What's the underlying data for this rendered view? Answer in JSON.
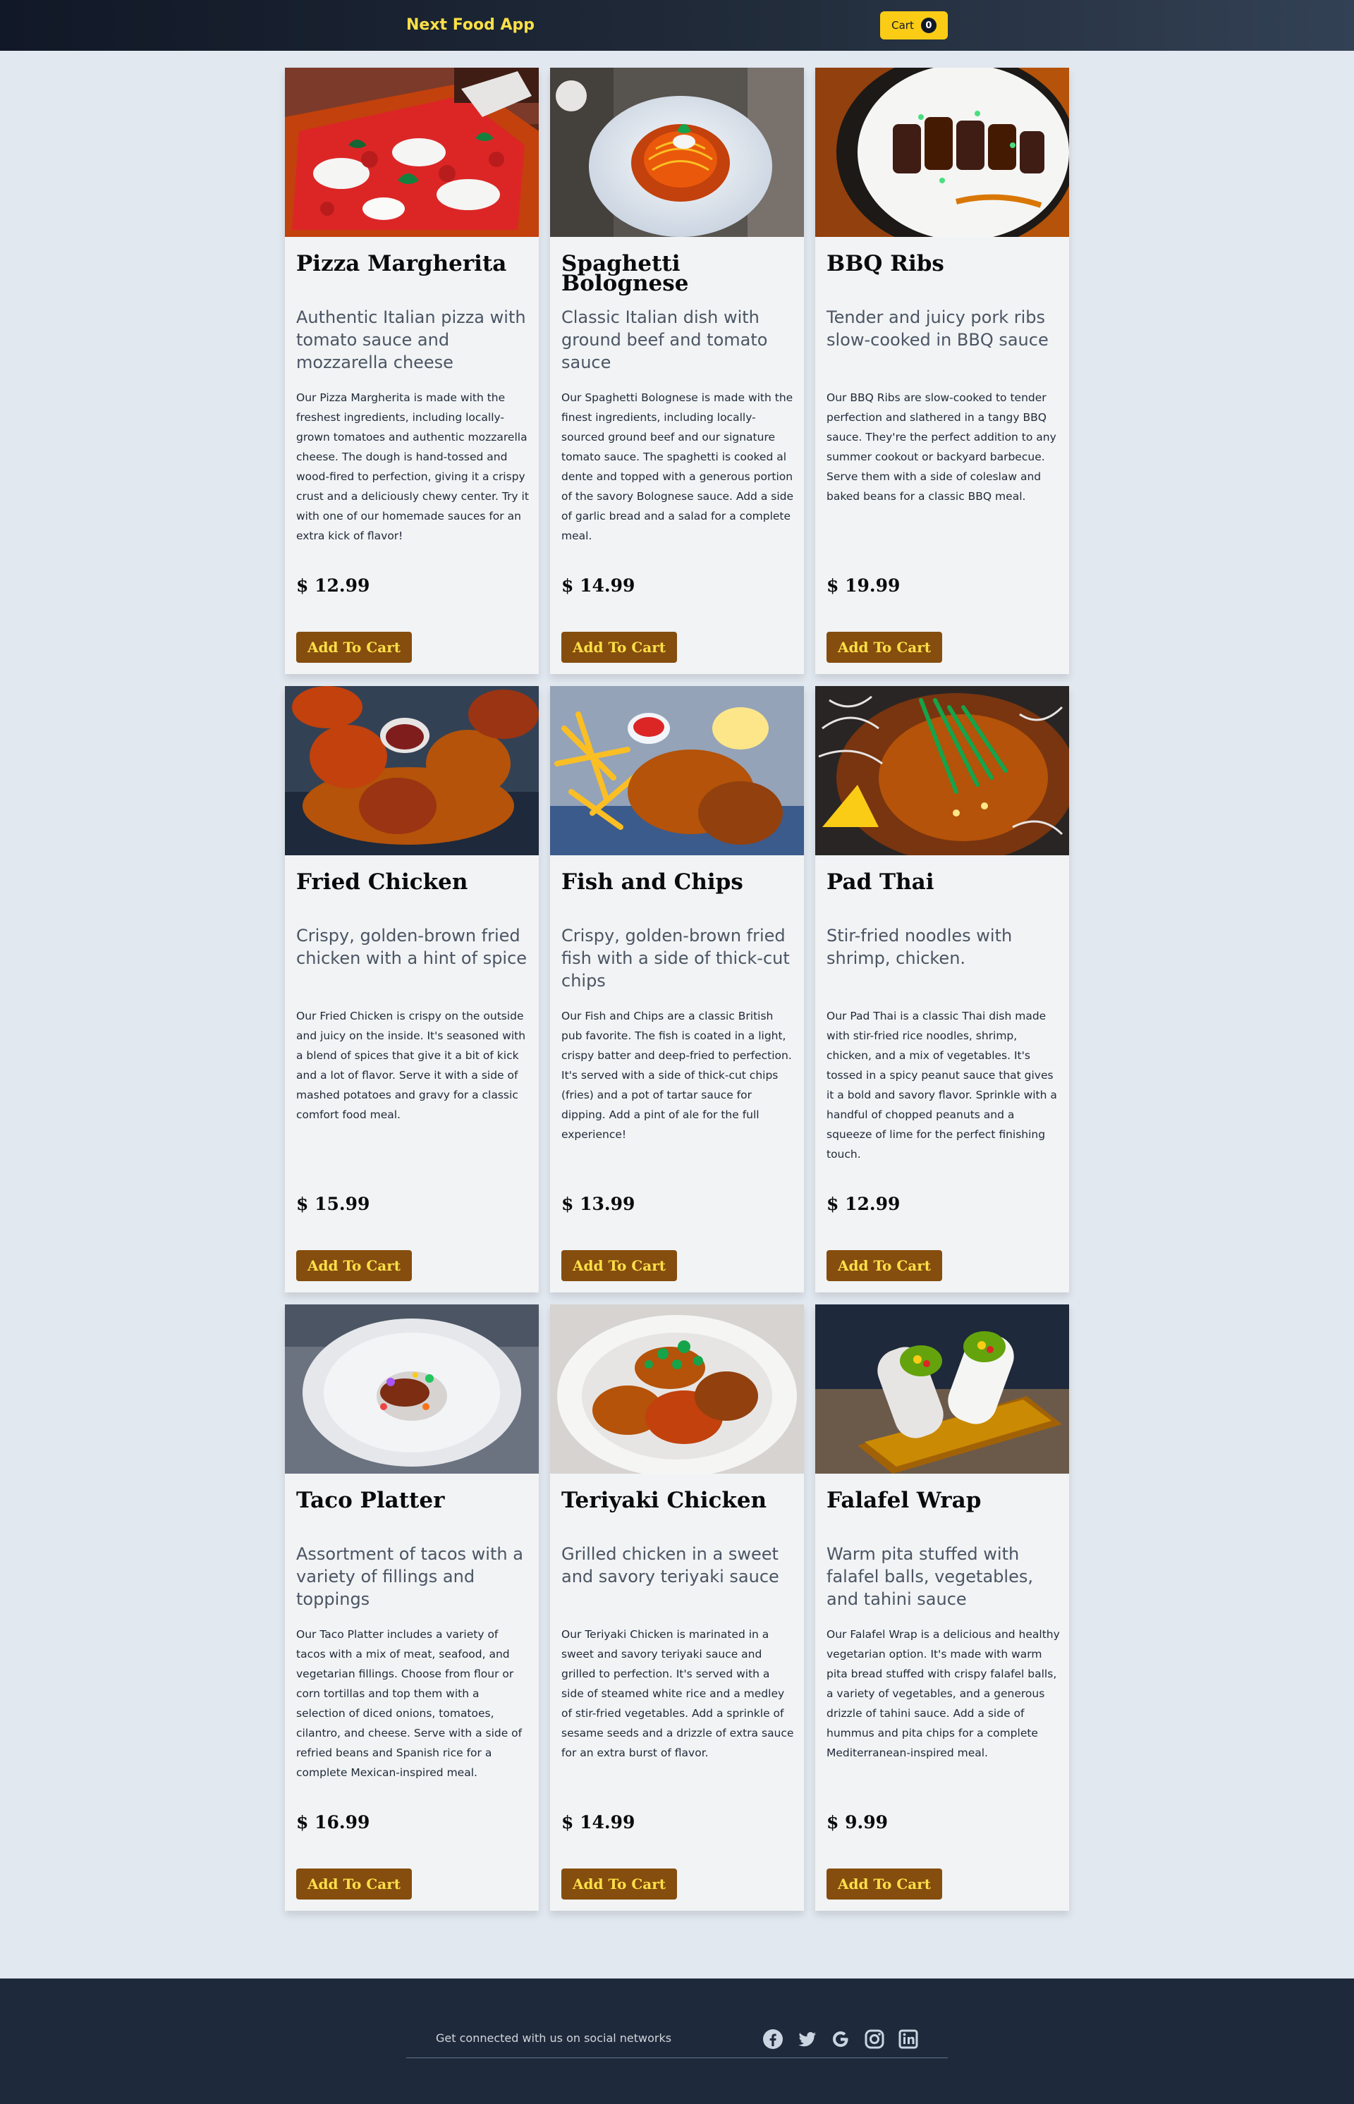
{
  "header": {
    "brand": "Next Food App",
    "cart_label": "Cart",
    "cart_count": "0"
  },
  "products": [
    {
      "title": "Pizza Margherita",
      "subtitle": "Authentic Italian pizza with tomato sauce and mozzarella cheese",
      "description": "Our Pizza Margherita is made with the freshest ingredients, including locally-grown tomatoes and authentic mozzarella cheese. The dough is hand-tossed and wood-fired to perfection, giving it a crispy crust and a deliciously chewy center. Try it with one of our homemade sauces for an extra kick of flavor!",
      "price": "$ 12.99",
      "button": "Add To Cart"
    },
    {
      "title": "Spaghetti Bolognese",
      "subtitle": "Classic Italian dish with ground beef and tomato sauce",
      "description": "Our Spaghetti Bolognese is made with the finest ingredients, including locally-sourced ground beef and our signature tomato sauce. The spaghetti is cooked al dente and topped with a generous portion of the savory Bolognese sauce. Add a side of garlic bread and a salad for a complete meal.",
      "price": "$ 14.99",
      "button": "Add To Cart"
    },
    {
      "title": "BBQ Ribs",
      "subtitle": "Tender and juicy pork ribs slow-cooked in BBQ sauce",
      "description": "Our BBQ Ribs are slow-cooked to tender perfection and slathered in a tangy BBQ sauce. They're the perfect addition to any summer cookout or backyard barbecue. Serve them with a side of coleslaw and baked beans for a classic BBQ meal.",
      "price": "$ 19.99",
      "button": "Add To Cart"
    },
    {
      "title": "Fried Chicken",
      "subtitle": "Crispy, golden-brown fried chicken with a hint of spice",
      "description": "Our Fried Chicken is crispy on the outside and juicy on the inside. It's seasoned with a blend of spices that give it a bit of kick and a lot of flavor. Serve it with a side of mashed potatoes and gravy for a classic comfort food meal.",
      "price": "$ 15.99",
      "button": "Add To Cart"
    },
    {
      "title": "Fish and Chips",
      "subtitle": "Crispy, golden-brown fried fish with a side of thick-cut chips",
      "description": "Our Fish and Chips are a classic British pub favorite. The fish is coated in a light, crispy batter and deep-fried to perfection. It's served with a side of thick-cut chips (fries) and a pot of tartar sauce for dipping. Add a pint of ale for the full experience!",
      "price": "$ 13.99",
      "button": "Add To Cart"
    },
    {
      "title": "Pad Thai",
      "subtitle": "Stir-fried noodles with shrimp, chicken.",
      "description": "Our Pad Thai is a classic Thai dish made with stir-fried rice noodles, shrimp, chicken, and a mix of vegetables. It's tossed in a spicy peanut sauce that gives it a bold and savory flavor. Sprinkle with a handful of chopped peanuts and a squeeze of lime for the perfect finishing touch.",
      "price": "$ 12.99",
      "button": "Add To Cart"
    },
    {
      "title": "Taco Platter",
      "subtitle": "Assortment of tacos with a variety of fillings and toppings",
      "description": "Our Taco Platter includes a variety of tacos with a mix of meat, seafood, and vegetarian fillings. Choose from flour or corn tortillas and top them with a selection of diced onions, tomatoes, cilantro, and cheese. Serve with a side of refried beans and Spanish rice for a complete Mexican-inspired meal.",
      "price": "$ 16.99",
      "button": "Add To Cart"
    },
    {
      "title": "Teriyaki Chicken",
      "subtitle": "Grilled chicken in a sweet and savory teriyaki sauce",
      "description": "Our Teriyaki Chicken is marinated in a sweet and savory teriyaki sauce and grilled to perfection. It's served with a side of steamed white rice and a medley of stir-fried vegetables. Add a sprinkle of sesame seeds and a drizzle of extra sauce for an extra burst of flavor.",
      "price": "$ 14.99",
      "button": "Add To Cart"
    },
    {
      "title": "Falafel Wrap",
      "subtitle": "Warm pita stuffed with falafel balls, vegetables, and tahini sauce",
      "description": "Our Falafel Wrap is a delicious and healthy vegetarian option. It's made with warm pita bread stuffed with crispy falafel balls, a variety of vegetables, and a generous drizzle of tahini sauce. Add a side of hummus and pita chips for a complete Mediterranean-inspired meal.",
      "price": "$ 9.99",
      "button": "Add To Cart"
    }
  ],
  "footer": {
    "text": "Get connected with us on social networks",
    "socials": [
      "facebook-icon",
      "twitter-icon",
      "google-icon",
      "instagram-icon",
      "linkedin-icon"
    ]
  },
  "colors": {
    "brand": "#fde047",
    "button_bg": "#854d0e",
    "button_text": "#fde047",
    "cart_bg": "#facc15",
    "page_bg": "#e2e8f0",
    "footer_bg": "#1e293b"
  }
}
